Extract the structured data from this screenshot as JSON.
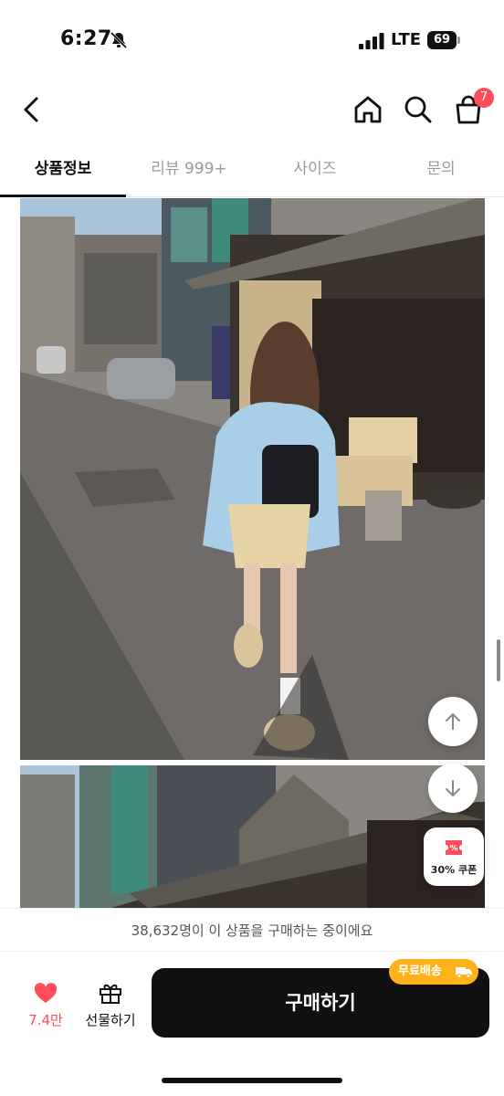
{
  "status_bar": {
    "time": "6:27",
    "network": "LTE",
    "battery": "69"
  },
  "header": {
    "cart_count": "7"
  },
  "tabs": [
    {
      "label": "상품정보",
      "active": true
    },
    {
      "label": "리뷰 999+",
      "active": false
    },
    {
      "label": "사이즈",
      "active": false
    },
    {
      "label": "문의",
      "active": false
    }
  ],
  "coupon": {
    "label": "30% 쿠폰"
  },
  "purchase_notice": "38,632명이 이 상품을 구매하는 중이에요",
  "bottom_bar": {
    "like_count": "7.4만",
    "gift_label": "선물하기",
    "buy_label": "구매하기",
    "shipping_badge": "무료배송"
  },
  "colors": {
    "accent_red": "#ff4d5a",
    "badge_orange": "#ffb31a",
    "buy_button": "#111111"
  }
}
